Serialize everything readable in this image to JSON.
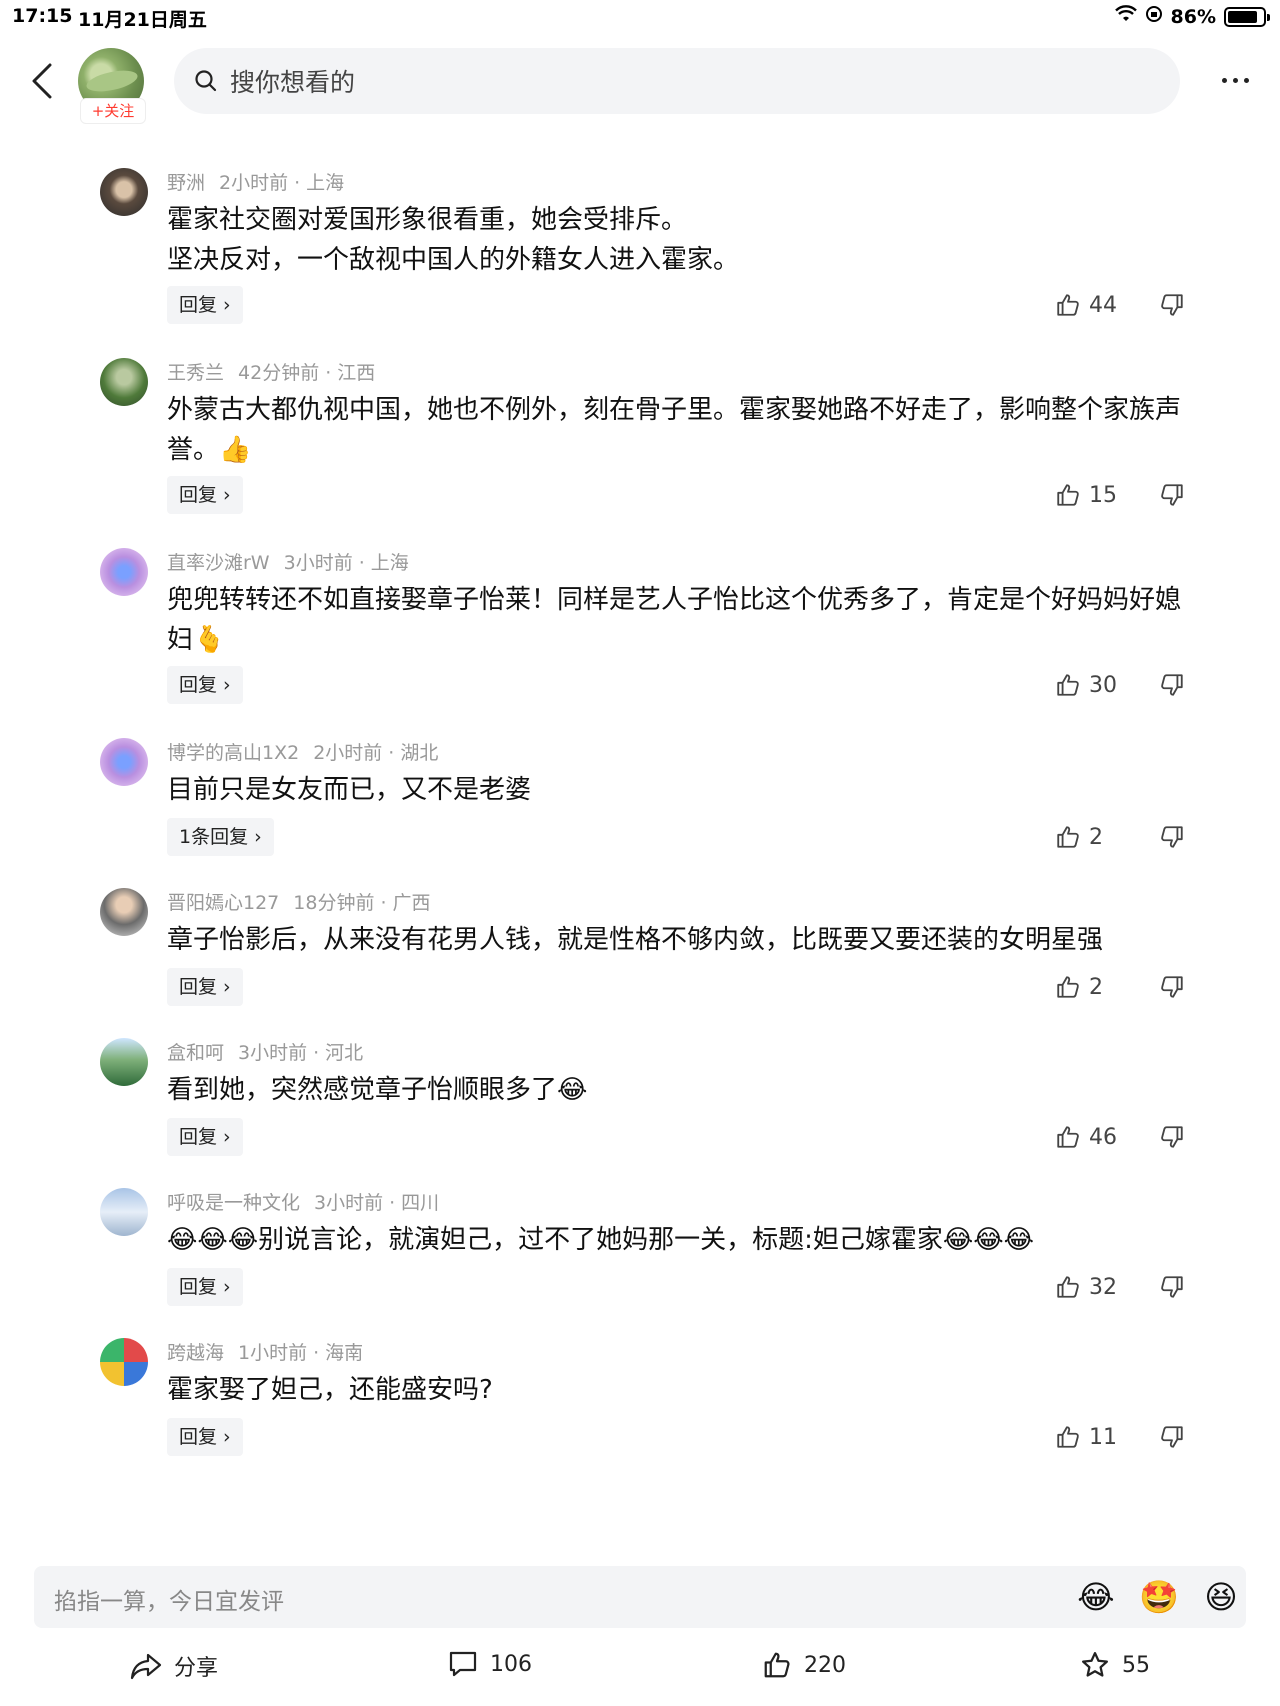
{
  "status_bar": {
    "time": "17:15",
    "date": "11月21日周五",
    "battery": "86%",
    "battery_level": 0.86
  },
  "header": {
    "follow_label": "+关注",
    "search_placeholder": "搜你想看的"
  },
  "comments": [
    {
      "user": "野洲",
      "time": "2小时前",
      "location": "上海",
      "text": "霍家社交圈对爱国形象很看重，她会受排斥。\n坚决反对，一个敌视中国人的外籍女人进入霍家。",
      "reply_label": "回复",
      "likes": "44"
    },
    {
      "user": "王秀兰",
      "time": "42分钟前",
      "location": "江西",
      "text": "外蒙古大都仇视中国，她也不例外，刻在骨子里。霍家娶她路不好走了，影响整个家族声誉。👍",
      "reply_label": "回复",
      "likes": "15"
    },
    {
      "user": "直率沙滩rW",
      "time": "3小时前",
      "location": "上海",
      "text": "兜兜转转还不如直接娶章子怡莱！同样是艺人子怡比这个优秀多了，肯定是个好妈妈好媳妇🫰",
      "reply_label": "回复",
      "likes": "30"
    },
    {
      "user": "博学的高山1X2",
      "time": "2小时前",
      "location": "湖北",
      "text": "目前只是女友而已，又不是老婆",
      "reply_label": "1条回复",
      "likes": "2"
    },
    {
      "user": "晋阳嫣心127",
      "time": "18分钟前",
      "location": "广西",
      "text": "章子怡影后，从来没有花男人钱，就是性格不够内敛，比既要又要还装的女明星强",
      "reply_label": "回复",
      "likes": "2"
    },
    {
      "user": "盒和呵",
      "time": "3小时前",
      "location": "河北",
      "text": "看到她，突然感觉章子怡顺眼多了😂",
      "reply_label": "回复",
      "likes": "46"
    },
    {
      "user": "呼吸是一种文化",
      "time": "3小时前",
      "location": "四川",
      "text": "😂😂😂别说言论，就演妲己，过不了她妈那一关，标题:妲己嫁霍家😂😂😂",
      "reply_label": "回复",
      "likes": "32"
    },
    {
      "user": "跨越海",
      "time": "1小时前",
      "location": "海南",
      "text": "霍家娶了妲己，还能盛安吗?",
      "reply_label": "回复",
      "likes": "11"
    }
  ],
  "input_bar": {
    "placeholder": "掐指一算，今日宜发评",
    "emojis": [
      "😂",
      "🤩",
      "😆"
    ]
  },
  "actions": {
    "share_label": "分享",
    "comments_count": "106",
    "likes_count": "220",
    "favorites_count": "55"
  }
}
